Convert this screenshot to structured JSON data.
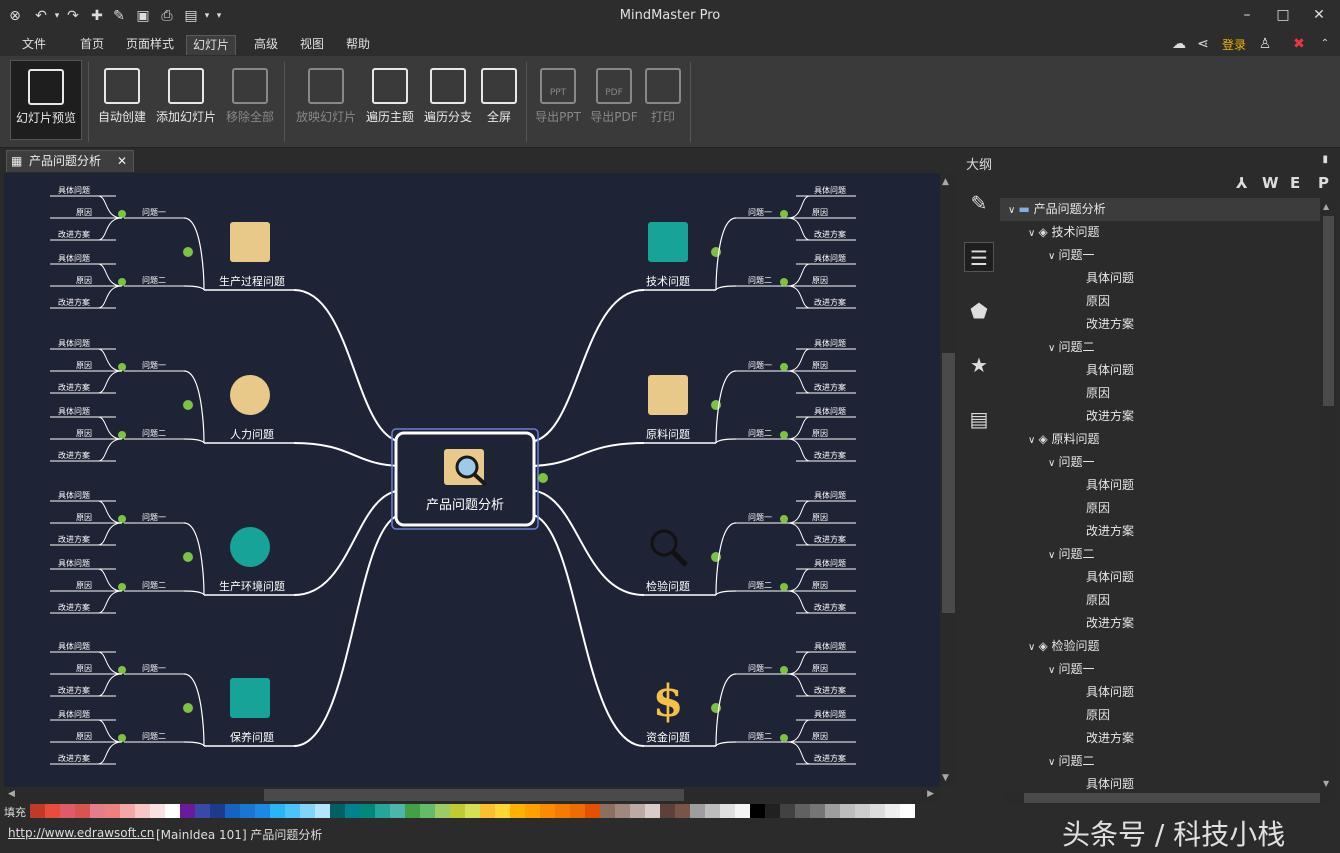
{
  "app_title": "MindMaster Pro",
  "menus": [
    "文件",
    "首页",
    "页面样式",
    "幻灯片",
    "高级",
    "视图",
    "帮助"
  ],
  "active_menu": "幻灯片",
  "login_label": "登录",
  "ribbon": [
    {
      "label": "幻灯片预览",
      "enabled": true,
      "selected": true
    },
    {
      "label": "自动创建",
      "enabled": true
    },
    {
      "label": "添加幻灯片",
      "enabled": true
    },
    {
      "label": "移除全部",
      "enabled": false
    },
    {
      "label": "放映幻灯片",
      "enabled": false
    },
    {
      "label": "遍历主题",
      "enabled": true
    },
    {
      "label": "遍历分支",
      "enabled": true
    },
    {
      "label": "全屏",
      "enabled": true
    },
    {
      "label": "导出PPT",
      "enabled": false,
      "badge": "PPT"
    },
    {
      "label": "导出PDF",
      "enabled": false,
      "badge": "PDF"
    },
    {
      "label": "打印",
      "enabled": false
    }
  ],
  "doc_tab": "产品问题分析",
  "panel_title": "大纲",
  "export_letters": [
    "W",
    "E",
    "P"
  ],
  "central_topic": "产品问题分析",
  "branches": [
    {
      "label": "生产过程问题",
      "side": "left",
      "icon": "box-icon"
    },
    {
      "label": "人力问题",
      "side": "left",
      "icon": "people-icon"
    },
    {
      "label": "生产环境问题",
      "side": "left",
      "icon": "globe-icon"
    },
    {
      "label": "保养问题",
      "side": "left",
      "icon": "worker-icon"
    },
    {
      "label": "技术问题",
      "side": "right",
      "icon": "monitor-icon"
    },
    {
      "label": "原料问题",
      "side": "right",
      "icon": "crates-icon"
    },
    {
      "label": "检验问题",
      "side": "right",
      "icon": "magnifier-icon"
    },
    {
      "label": "资金问题",
      "side": "right",
      "icon": "dollar-icon"
    }
  ],
  "subtopics": [
    "问题一",
    "问题二"
  ],
  "leaves": [
    "具体问题",
    "原因",
    "改进方案"
  ],
  "outline": [
    {
      "text": "产品问题分析",
      "level": 0,
      "type": "folder",
      "selected": true
    },
    {
      "text": "技术问题",
      "level": 1,
      "type": "layers"
    },
    {
      "text": "问题一",
      "level": 2,
      "type": "arrow"
    },
    {
      "text": "具体问题",
      "level": 3
    },
    {
      "text": "原因",
      "level": 3
    },
    {
      "text": "改进方案",
      "level": 3
    },
    {
      "text": "问题二",
      "level": 2,
      "type": "arrow"
    },
    {
      "text": "具体问题",
      "level": 3
    },
    {
      "text": "原因",
      "level": 3
    },
    {
      "text": "改进方案",
      "level": 3
    },
    {
      "text": "原料问题",
      "level": 1,
      "type": "layers"
    },
    {
      "text": "问题一",
      "level": 2,
      "type": "arrow"
    },
    {
      "text": "具体问题",
      "level": 3
    },
    {
      "text": "原因",
      "level": 3
    },
    {
      "text": "改进方案",
      "level": 3
    },
    {
      "text": "问题二",
      "level": 2,
      "type": "arrow"
    },
    {
      "text": "具体问题",
      "level": 3
    },
    {
      "text": "原因",
      "level": 3
    },
    {
      "text": "改进方案",
      "level": 3
    },
    {
      "text": "检验问题",
      "level": 1,
      "type": "layers"
    },
    {
      "text": "问题一",
      "level": 2,
      "type": "arrow"
    },
    {
      "text": "具体问题",
      "level": 3
    },
    {
      "text": "原因",
      "level": 3
    },
    {
      "text": "改进方案",
      "level": 3
    },
    {
      "text": "问题二",
      "level": 2,
      "type": "arrow"
    },
    {
      "text": "具体问题",
      "level": 3
    }
  ],
  "palette_label": "填充",
  "palette_colors": [
    "#c0392b",
    "#e74c3c",
    "#e05a6a",
    "#d9534f",
    "#e67e8a",
    "#f08080",
    "#f4a7a7",
    "#f7c6c6",
    "#fbe0e0",
    "#ffffff",
    "#6a1b9a",
    "#3949ab",
    "#1e3a8a",
    "#1565c0",
    "#1976d2",
    "#1e88e5",
    "#29b6f6",
    "#4fc3f7",
    "#81d4fa",
    "#b3e5fc",
    "#006064",
    "#00838f",
    "#00897b",
    "#26a69a",
    "#4db6ac",
    "#43a047",
    "#66bb6a",
    "#9ccc65",
    "#c0ca33",
    "#d4e157",
    "#fbc02d",
    "#fdd835",
    "#ffb300",
    "#ffa000",
    "#fb8c00",
    "#f57c00",
    "#ef6c00",
    "#e65100",
    "#8d6e63",
    "#a1887f",
    "#bcaaa4",
    "#d7ccc8",
    "#5d4037",
    "#795548",
    "#9e9e9e",
    "#bdbdbd",
    "#e0e0e0",
    "#f5f5f5",
    "#000000",
    "#212121",
    "#424242",
    "#616161",
    "#757575",
    "#9e9e9e",
    "#bdbdbd",
    "#cccccc",
    "#dddddd",
    "#eeeeee",
    "#ffffff"
  ],
  "status_url": "http://www.edrawsoft.cn",
  "status_info": "[MainIdea 101]  产品问题分析",
  "watermark": "头条号 / 科技小栈",
  "colors": {
    "canvas_bg": "#1f2336",
    "accent_green": "#7dc242",
    "icon_tan": "#e8c98a",
    "icon_teal": "#17a398"
  }
}
